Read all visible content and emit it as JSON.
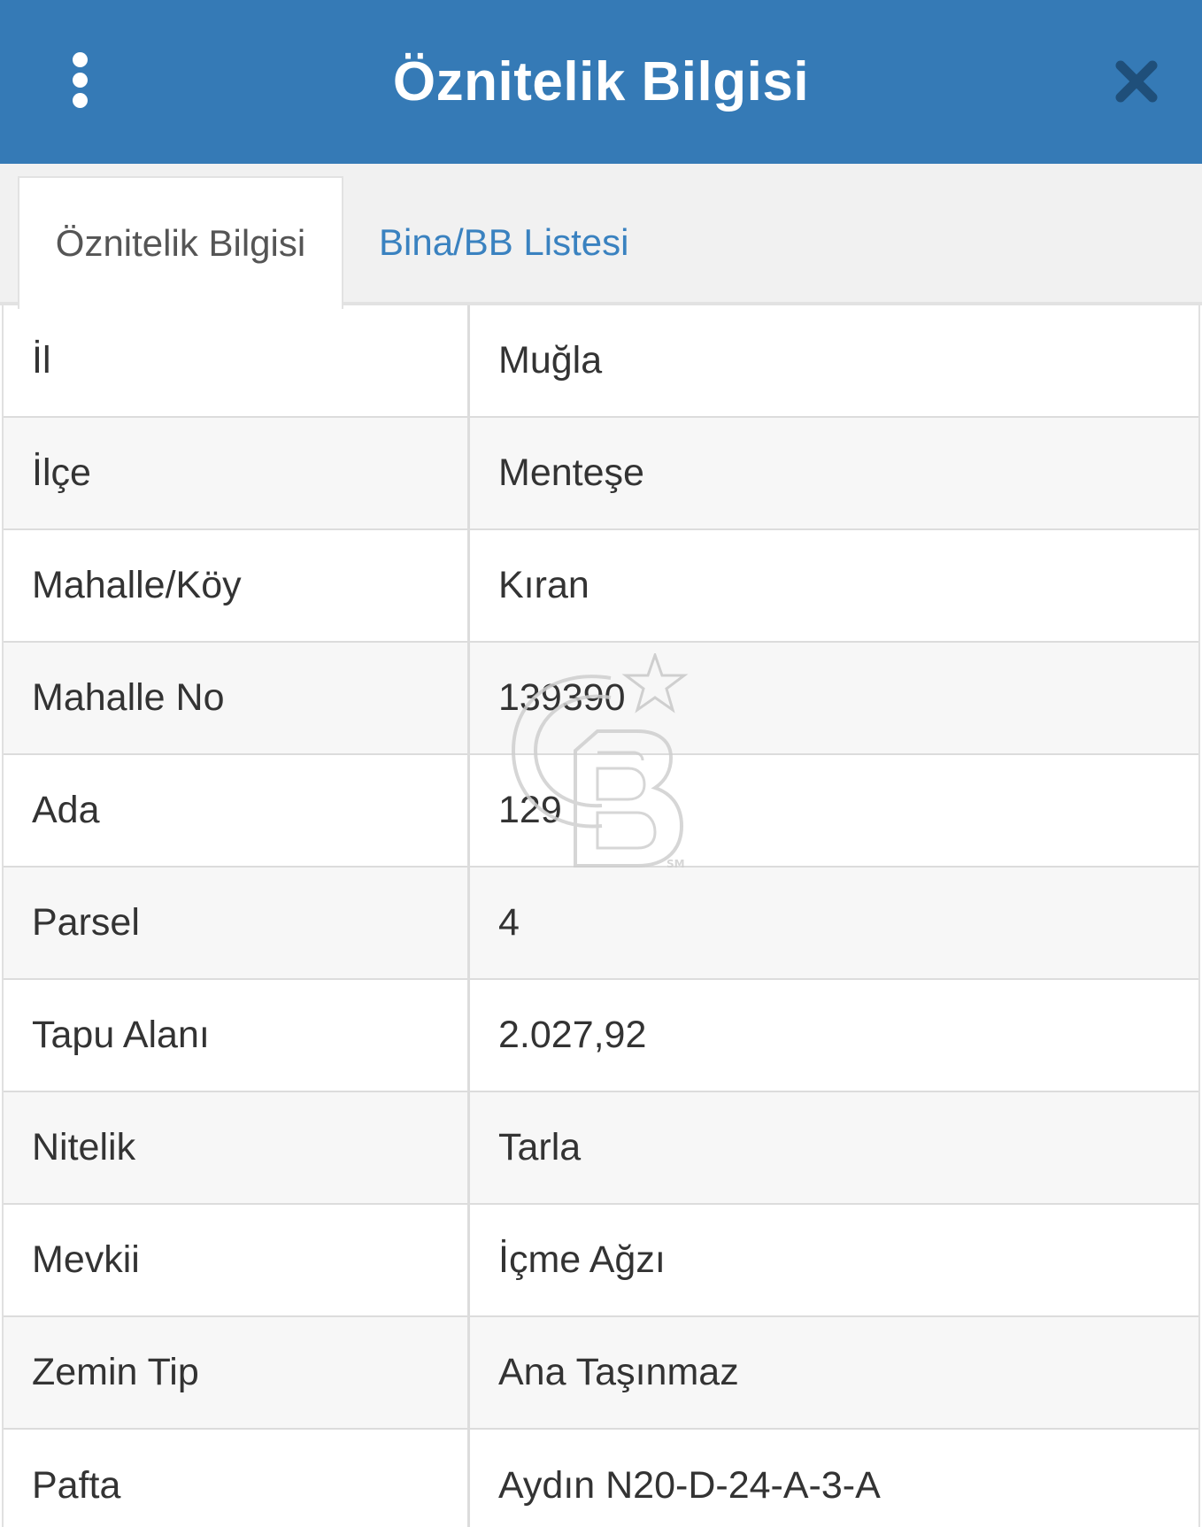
{
  "header": {
    "title": "Öznitelik Bilgisi",
    "menu_icon": "more-vertical-icon",
    "close_icon": "close-icon",
    "background_color": "#357ab6"
  },
  "tabs": [
    {
      "label": "Öznitelik Bilgisi",
      "active": true
    },
    {
      "label": "Bina/BB Listesi",
      "active": false
    }
  ],
  "attributes": [
    {
      "label": "İl",
      "value": "Muğla"
    },
    {
      "label": "İlçe",
      "value": "Menteşe"
    },
    {
      "label": "Mahalle/Köy",
      "value": "Kıran"
    },
    {
      "label": "Mahalle No",
      "value": "139390"
    },
    {
      "label": "Ada",
      "value": "129"
    },
    {
      "label": "Parsel",
      "value": "4"
    },
    {
      "label": "Tapu Alanı",
      "value": "2.027,92"
    },
    {
      "label": "Nitelik",
      "value": "Tarla"
    },
    {
      "label": "Mevkii",
      "value": "İçme Ağzı"
    },
    {
      "label": "Zemin Tip",
      "value": "Ana Taşınmaz"
    },
    {
      "label": "Pafta",
      "value": "Aydın N20-D-24-A-3-A"
    }
  ],
  "watermark": {
    "icon": "cb-logo-watermark",
    "mark_text": "SM"
  }
}
